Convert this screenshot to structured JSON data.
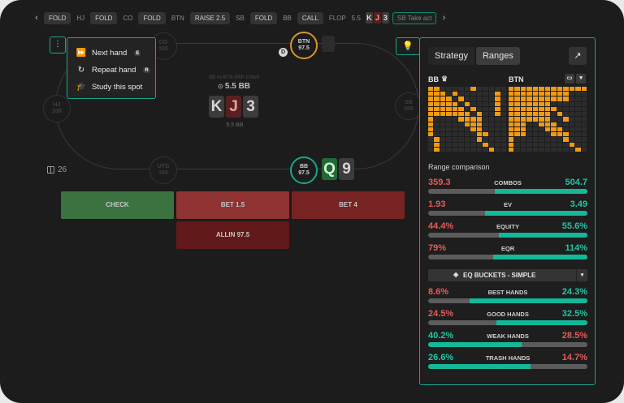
{
  "history": {
    "actions": [
      {
        "pos": "",
        "act": "FOLD"
      },
      {
        "pos": "HJ",
        "act": "FOLD"
      },
      {
        "pos": "CO",
        "act": "FOLD"
      },
      {
        "pos": "BTN",
        "act": "RAISE 2.5"
      },
      {
        "pos": "SB",
        "act": "FOLD"
      },
      {
        "pos": "BB",
        "act": "CALL"
      }
    ],
    "flop_label": "FLOP",
    "flop_pot": "5.5",
    "flop_cards": [
      "K",
      "J",
      "3"
    ],
    "take_action": "SB  Take act"
  },
  "table": {
    "seats": {
      "co": {
        "pos": "CO",
        "stack": "100"
      },
      "btn": {
        "pos": "BTN",
        "stack": "97.5"
      },
      "hj": {
        "pos": "HJ",
        "stack": "100"
      },
      "sb": {
        "pos": "SB",
        "stack": "100"
      },
      "utg": {
        "pos": "UTG",
        "stack": "100"
      },
      "bb": {
        "pos": "BB",
        "stack": "97.5"
      }
    },
    "dealer": "D",
    "pot_desc": "BB vs BTN SRP 100bb",
    "pot_size": "5.5 BB",
    "pot_bottom": "5.5 BB",
    "board": [
      "K",
      "J",
      "3"
    ],
    "hero_cards": [
      "Q",
      "9"
    ],
    "hand_counter": "26"
  },
  "actions": {
    "check": "CHECK",
    "bet15": "BET 1.5",
    "bet4": "BET 4",
    "allin": "ALLIN 97.5"
  },
  "menu": {
    "toggle": "⋮",
    "next_hand": "Next hand",
    "next_key": "E",
    "repeat_hand": "Repeat hand",
    "repeat_key": "R",
    "study": "Study this spot"
  },
  "panel": {
    "tab_strategy": "Strategy",
    "tab_ranges": "Ranges",
    "player_left": "BB",
    "player_right": "BTN",
    "range_comparison": "Range comparison",
    "metrics": [
      {
        "label": "COMBOS",
        "left": "359.3",
        "right": "504.7",
        "right_share": 0.584
      },
      {
        "label": "EV",
        "left": "1.93",
        "right": "3.49",
        "right_share": 0.644
      },
      {
        "label": "EQUITY",
        "left": "44.4%",
        "right": "55.6%",
        "right_share": 0.556
      },
      {
        "label": "EQR",
        "left": "79%",
        "right": "114%",
        "right_share": 0.59
      }
    ],
    "bucket_select": "EQ BUCKETS - SIMPLE",
    "buckets": [
      {
        "label": "BEST HANDS",
        "left": "8.6%",
        "right": "24.3%",
        "right_share": 0.739
      },
      {
        "label": "GOOD HANDS",
        "left": "24.5%",
        "right": "32.5%",
        "right_share": 0.57
      },
      {
        "label": "WEAK HANDS",
        "left": "40.2%",
        "right": "28.5%",
        "right_share": 0.415
      },
      {
        "label": "TRASH HANDS",
        "left": "26.6%",
        "right": "14.7%",
        "right_share": 0.356
      }
    ],
    "colors": {
      "accent": "#18a58f",
      "range": "#f29a14",
      "left_value": "#e65b5b",
      "right_value": "#21c7a3"
    }
  }
}
